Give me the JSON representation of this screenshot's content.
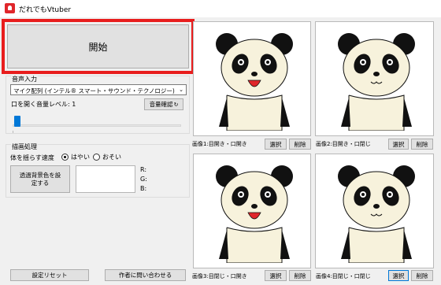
{
  "window": {
    "title": "だれでもVtuber"
  },
  "start_button": {
    "label": "開始"
  },
  "audio": {
    "section_label": "音声入力",
    "device": "マイク配列 (インテル® スマート・サウンド・テクノロジー)",
    "mouth_level_label": "口を開く音量レベル: 1",
    "volume_check_label": "音量確認",
    "mouth_level": 1
  },
  "render": {
    "section_label": "描画処理",
    "speed_label": "体を揺らす速度",
    "speed_fast": "はやい",
    "speed_slow": "おそい",
    "selected_speed": "はやい",
    "transparent_color_label": "透過背景色を設定する",
    "r_label": "R:",
    "g_label": "G:",
    "b_label": "B:"
  },
  "footer": {
    "reset_label": "設定リセット",
    "contact_label": "作者に問い合わせる"
  },
  "images": [
    {
      "caption": "画像1:目開き・口開き",
      "select": "選択",
      "delete": "削除",
      "eyes": "open",
      "mouth": "open"
    },
    {
      "caption": "画像2:目開き・口閉じ",
      "select": "選択",
      "delete": "削除",
      "eyes": "open",
      "mouth": "closed"
    },
    {
      "caption": "画像3:目閉じ・口開き",
      "select": "選択",
      "delete": "削除",
      "eyes": "open",
      "mouth": "open"
    },
    {
      "caption": "画像4:目閉じ・口閉じ",
      "select": "選択",
      "delete": "削除",
      "eyes": "open",
      "mouth": "closed"
    }
  ],
  "colors": {
    "highlight": "#e81d1d",
    "accent": "#0078d7",
    "panda_face": "#f7f2dc",
    "tongue": "#e0262b"
  }
}
